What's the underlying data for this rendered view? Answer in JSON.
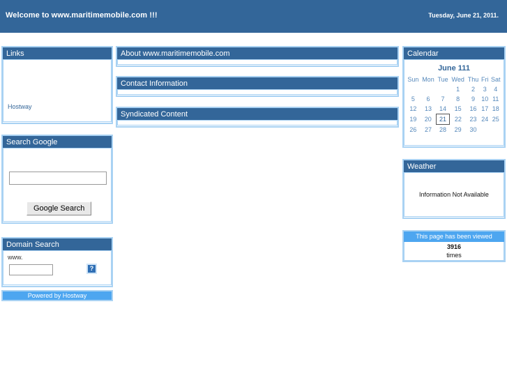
{
  "banner": {
    "title": "Welcome to www.maritimemobile.com !!!",
    "date": "Tuesday, June 21, 2011.",
    "background_color": "#336699"
  },
  "theme": {
    "header_blue": "#336699",
    "border_blue": "#a9d2f3",
    "light_blue": "#4da6f0",
    "link_blue": "#336699"
  },
  "sidebar": {
    "links_panel": {
      "title": "Links",
      "links": [
        {
          "label": "Hostway"
        }
      ]
    },
    "google_panel": {
      "title": "Search Google",
      "input_value": "",
      "input_placeholder": "",
      "button_label": "Google Search"
    },
    "domain_panel": {
      "title": "Domain Search",
      "prefix_label": "www.",
      "input_value": "",
      "input_placeholder": "",
      "help_icon": "question-mark-icon",
      "help_label": "?"
    },
    "powered_by": "Powered by Hostway"
  },
  "main": {
    "panels": [
      {
        "title": "About www.maritimemobile.com",
        "body": ""
      },
      {
        "title": "Contact Information",
        "body": ""
      },
      {
        "title": "Syndicated Content",
        "body": ""
      }
    ]
  },
  "right": {
    "calendar": {
      "title": "Calendar",
      "month_label": "June 111",
      "weekdays": [
        "Sun",
        "Mon",
        "Tue",
        "Wed",
        "Thu",
        "Fri",
        "Sat"
      ],
      "weeks": [
        [
          "",
          "",
          "",
          "1",
          "2",
          "3",
          "4"
        ],
        [
          "5",
          "6",
          "7",
          "8",
          "9",
          "10",
          "11"
        ],
        [
          "12",
          "13",
          "14",
          "15",
          "16",
          "17",
          "18"
        ],
        [
          "19",
          "20",
          "21",
          "22",
          "23",
          "24",
          "25"
        ],
        [
          "26",
          "27",
          "28",
          "29",
          "30",
          "",
          ""
        ]
      ],
      "today": "21"
    },
    "weather": {
      "title": "Weather",
      "message": "Information Not Available"
    },
    "counter": {
      "title": "This page has been viewed",
      "count": "3916",
      "unit": "times"
    }
  }
}
